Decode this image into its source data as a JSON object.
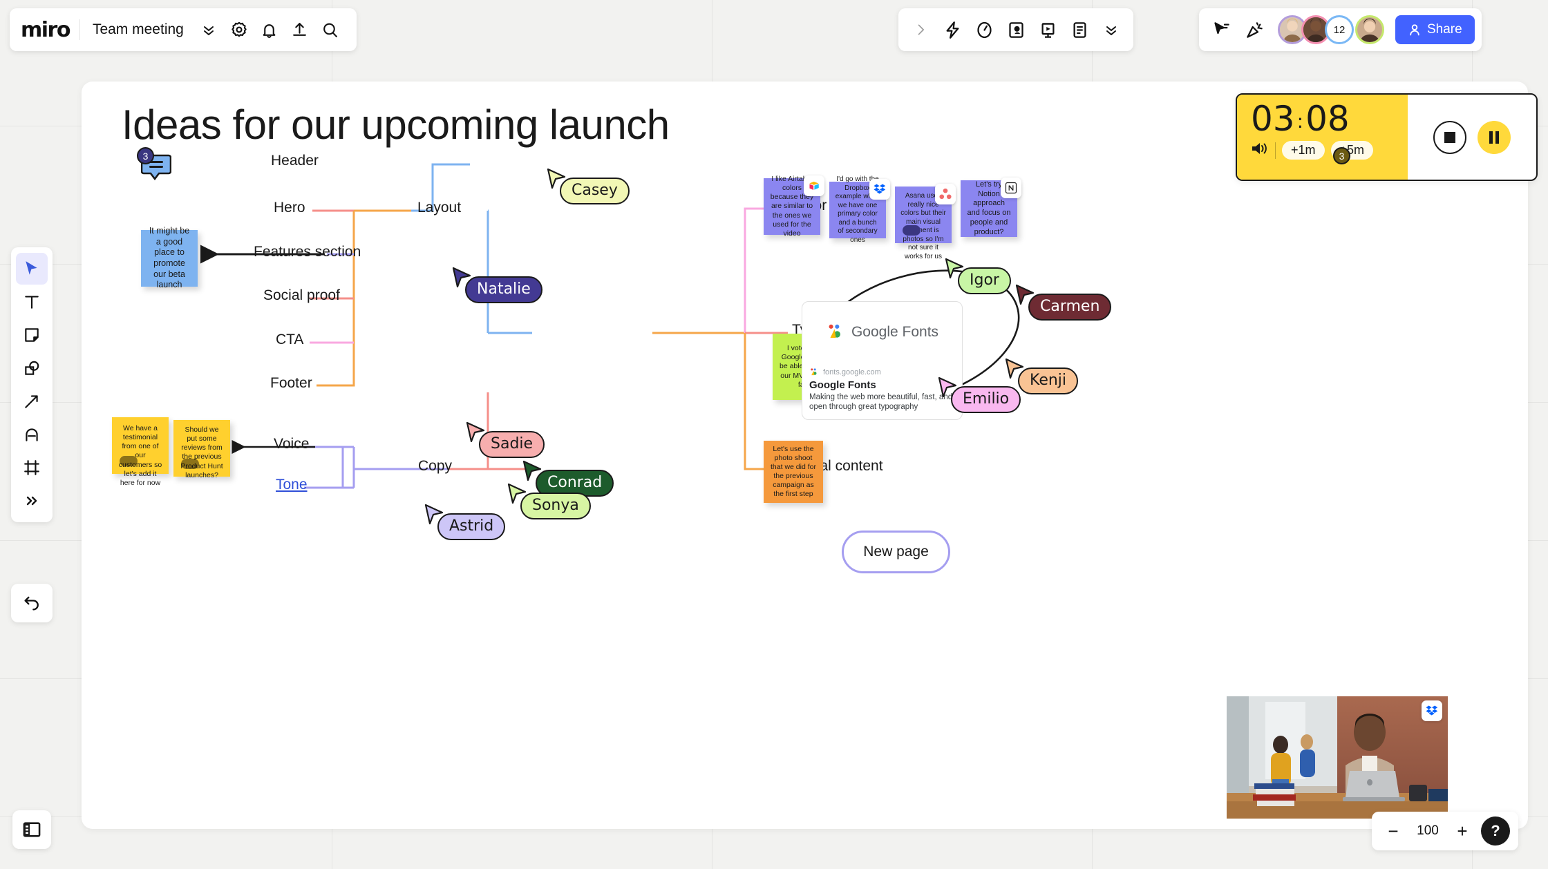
{
  "app": {
    "logo_text": "miro",
    "board_name": "Team meeting"
  },
  "topbar_left": {
    "icons": [
      {
        "name": "board-menu-chevron-icon",
        "label": "Board menu"
      },
      {
        "name": "gear-icon",
        "label": "Settings"
      },
      {
        "name": "bell-icon",
        "label": "Notifications"
      },
      {
        "name": "upload-icon",
        "label": "Export"
      },
      {
        "name": "search-icon",
        "label": "Search"
      }
    ]
  },
  "topbar_center": {
    "icons": [
      {
        "name": "chevron-right-icon",
        "label": "Expand"
      },
      {
        "name": "lightning-icon",
        "label": "Apps"
      },
      {
        "name": "timer-icon",
        "label": "Timer"
      },
      {
        "name": "video-chat-icon",
        "label": "Video chat"
      },
      {
        "name": "presentation-icon",
        "label": "Presentation mode"
      },
      {
        "name": "notes-icon",
        "label": "Notes"
      },
      {
        "name": "chevron-double-down-icon",
        "label": "More"
      }
    ]
  },
  "topbar_right": {
    "icons": [
      {
        "name": "cursor-follow-icon",
        "label": "Bring to me"
      },
      {
        "name": "confetti-icon",
        "label": "Reactions"
      }
    ],
    "collaborator_count": "12",
    "share_label": "Share",
    "share_color": "#4262ff"
  },
  "left_rail": {
    "tools": [
      {
        "name": "select-tool",
        "label": "Select",
        "active": true
      },
      {
        "name": "text-tool",
        "label": "Text"
      },
      {
        "name": "sticky-note-tool",
        "label": "Sticky note"
      },
      {
        "name": "shapes-tool",
        "label": "Shapes"
      },
      {
        "name": "connector-tool",
        "label": "Connection line"
      },
      {
        "name": "pen-tool",
        "label": "Pen"
      },
      {
        "name": "frame-tool",
        "label": "Frame"
      },
      {
        "name": "more-tools",
        "label": "More tools"
      }
    ],
    "undo_label": "Undo",
    "panel_toggle_label": "Toggle panel"
  },
  "zoom_controls": {
    "minus_label": "−",
    "value": "100",
    "plus_label": "+",
    "help_label": "?"
  },
  "timer": {
    "minutes": "03",
    "separator": ":",
    "seconds": "08",
    "add_one_label": "+1m",
    "add_five_label": "+5m",
    "sound_icon": "speaker-icon",
    "stop_label": "Stop",
    "pause_label": "Pause",
    "accent_color": "#ffd93b"
  },
  "board": {
    "title": "Ideas for our upcoming launch",
    "center_node": "New page",
    "mindmap_left": [
      {
        "label": "Header",
        "color": "#7eb3f0"
      },
      {
        "label": "Hero",
        "color": "#f58f8a"
      },
      {
        "label": "Features section",
        "color": "#a59ef0"
      },
      {
        "label": "Social proof",
        "color": "#f58f8a"
      },
      {
        "label": "CTA",
        "color": "#f9a8e0"
      },
      {
        "label": "Footer",
        "color": "#f5a64a"
      },
      {
        "label": "Layout",
        "color": "#f5a64a"
      },
      {
        "label": "Voice",
        "color": "#a59ef0"
      },
      {
        "label": "Tone",
        "color": "#a59ef0",
        "is_link": true
      },
      {
        "label": "Copy",
        "color": "#f58f8a"
      }
    ],
    "mindmap_right": [
      {
        "label": "Color",
        "color": "#f9a8e0"
      },
      {
        "label": "Typeface",
        "color": "#f58f8a"
      },
      {
        "label": "Visual content",
        "color": "#f5a64a"
      }
    ]
  },
  "sticky_notes": [
    {
      "id": "beta-launch-note",
      "text": "It might be a good place to promote our beta launch",
      "color": "#7eb3f0",
      "text_color": "#1a1a1a"
    },
    {
      "id": "testimonial-note",
      "text": "We have a testimonial from one of our customers so let's add it here for now",
      "color": "#ffd02e",
      "has_dot": true
    },
    {
      "id": "reviews-note",
      "text": "Should we put some reviews from the previous Product Hunt launches?",
      "color": "#ffd02e",
      "has_dot": true
    },
    {
      "id": "airtable-note",
      "text": "I like Airtable colors because they are similar to the ones we used for the video",
      "color": "#8b86f0",
      "brand": "airtable-icon"
    },
    {
      "id": "dropbox-note",
      "text": "I'd go with the Dropbox example when we have one primary color and a bunch of secondary ones",
      "color": "#8b86f0",
      "brand": "dropbox-icon"
    },
    {
      "id": "asana-note",
      "text": "Asana uses really nice colors but their main visual element is photos so I'm not sure it works for us",
      "color": "#8b86f0",
      "brand": "asana-icon",
      "has_dot": true
    },
    {
      "id": "notion-note",
      "text": "Let's try Notion approach and focus on people and product?",
      "color": "#8b86f0",
      "brand": "notion-icon"
    },
    {
      "id": "google-fonts-note",
      "text": "I vote for the Google Fonts to be able to launch our MVP version faster",
      "color": "#c3f04f"
    },
    {
      "id": "photo-shoot-note",
      "text": "Let's use the photo shoot that we did for the previous campaign as the first step",
      "color": "#f5993c"
    }
  ],
  "link_card": {
    "logo_text_bold": "Google",
    "logo_text_light": "Fonts",
    "url": "fonts.google.com",
    "heading": "Google Fonts",
    "description": "Making the web more beautiful, fast, and open through great typography"
  },
  "photo": {
    "name": "office-photo",
    "brand": "dropbox-icon"
  },
  "comment_badges": [
    {
      "id": "left-comment-badge",
      "count": "3",
      "color": "#7eb3f0",
      "badge_color": "#3a3680"
    },
    {
      "id": "right-comment-badge",
      "count": "3",
      "color": "#ffd93b",
      "badge_color": "#6b5a12"
    }
  ],
  "cursors": [
    {
      "name": "Natalie",
      "fill": "#433a93",
      "text": "#ffffff"
    },
    {
      "name": "Casey",
      "fill": "#f2f7b5",
      "text": "#1a1a1a"
    },
    {
      "name": "Igor",
      "fill": "#c8f5a5",
      "text": "#1a1a1a"
    },
    {
      "name": "Carmen",
      "fill": "#6e2b33",
      "text": "#ffffff"
    },
    {
      "name": "Kenji",
      "fill": "#f9c394",
      "text": "#1a1a1a"
    },
    {
      "name": "Emilio",
      "fill": "#f9b8ef",
      "text": "#1a1a1a"
    },
    {
      "name": "Sadie",
      "fill": "#f7aeae",
      "text": "#1a1a1a"
    },
    {
      "name": "Conrad",
      "fill": "#1d5b2c",
      "text": "#ffffff"
    },
    {
      "name": "Sonya",
      "fill": "#d7f5a3",
      "text": "#1a1a1a"
    },
    {
      "name": "Astrid",
      "fill": "#cdc6f7",
      "text": "#1a1a1a"
    }
  ]
}
